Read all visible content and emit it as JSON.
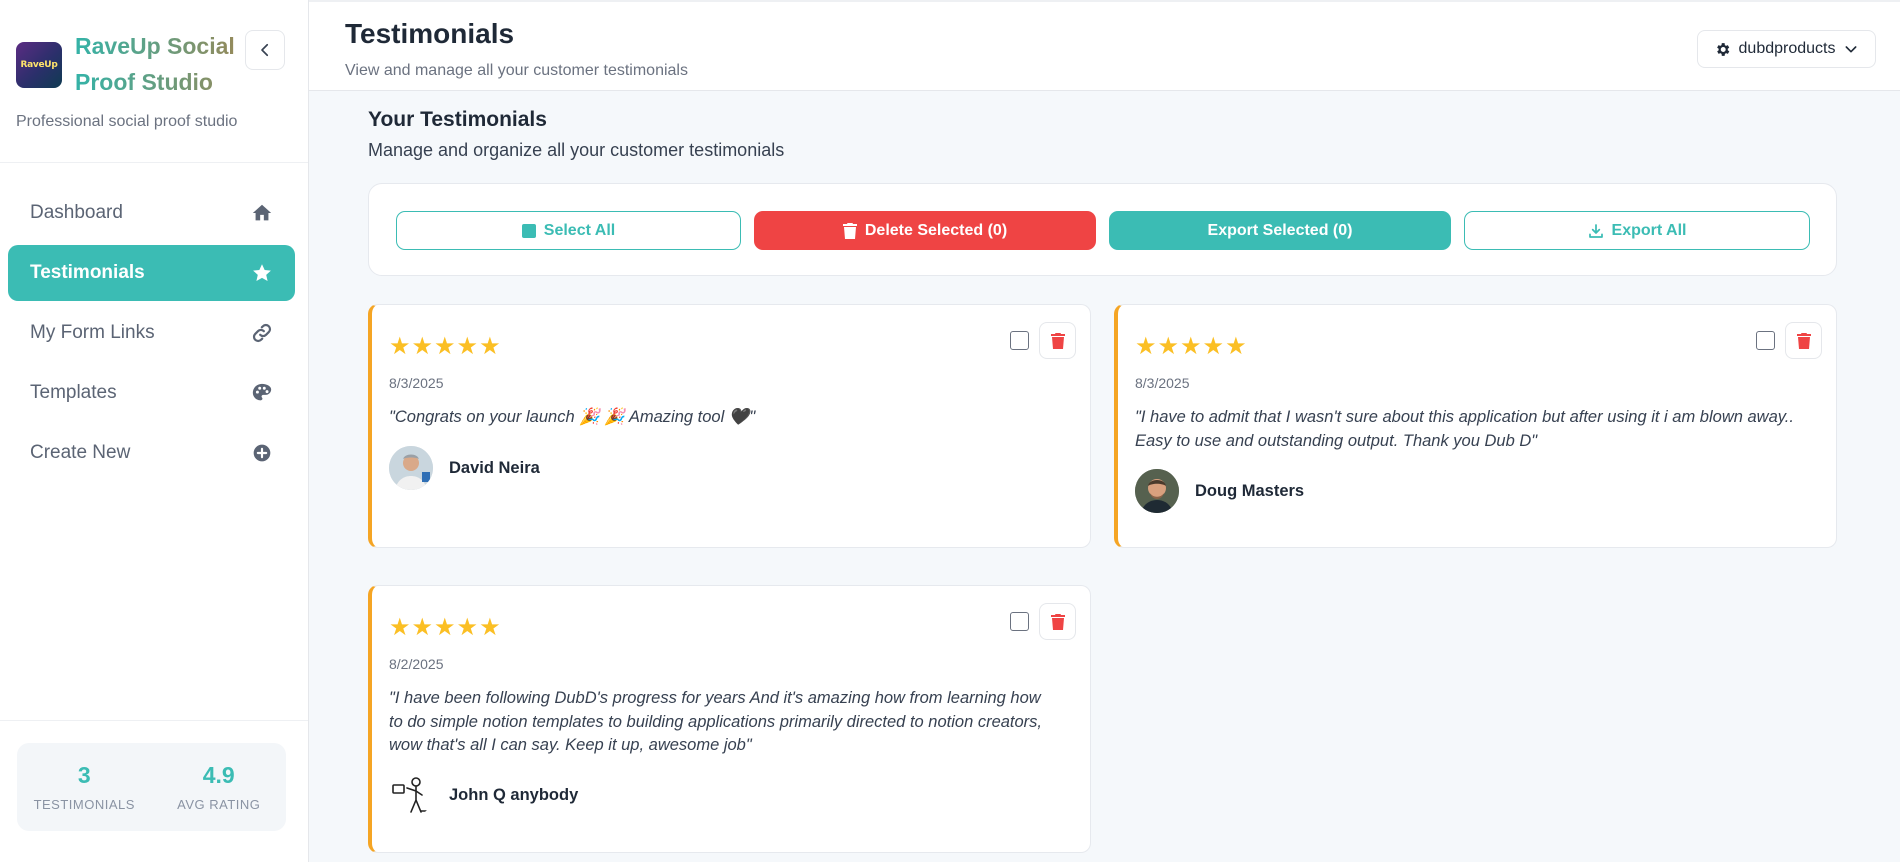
{
  "sidebar": {
    "logo_text": "RaveUp",
    "brand_name": "RaveUp Social Proof Studio",
    "tagline": "Professional social proof studio",
    "nav": [
      {
        "label": "Dashboard",
        "icon": "home-icon",
        "active": false
      },
      {
        "label": "Testimonials",
        "icon": "star-icon",
        "active": true
      },
      {
        "label": "My Form Links",
        "icon": "link-icon",
        "active": false
      },
      {
        "label": "Templates",
        "icon": "palette-icon",
        "active": false
      },
      {
        "label": "Create New",
        "icon": "plus-circle-icon",
        "active": false
      }
    ],
    "stats": [
      {
        "value": "3",
        "label": "TESTIMONIALS"
      },
      {
        "value": "4.9",
        "label": "AVG RATING"
      }
    ]
  },
  "header": {
    "title": "Testimonials",
    "subtitle": "View and manage all your customer testimonials",
    "account": "dubdproducts"
  },
  "main": {
    "section_title": "Your Testimonials",
    "section_subtitle": "Manage and organize all your customer testimonials",
    "toolbar": {
      "select_all": "Select All",
      "delete_selected": "Delete Selected (0)",
      "export_selected": "Export Selected (0)",
      "export_all": "Export All"
    },
    "testimonials": [
      {
        "rating": 5,
        "stars": "★★★★★",
        "date": "8/3/2025",
        "quote_lines": [
          "\"Congrats on your launch 🎉 🎉 Amazing tool 🖤\""
        ],
        "author": "David Neira"
      },
      {
        "rating": 5,
        "stars": "★★★★★",
        "date": "8/3/2025",
        "quote_lines": [
          "\"I have to admit that I wasn't sure about this application but after using it i am blown away..",
          "Easy to use and outstanding output. Thank you Dub D\""
        ],
        "author": "Doug Masters"
      },
      {
        "rating": 5,
        "stars": "★★★★★",
        "date": "8/2/2025",
        "quote_lines": [
          "\"I have been following DubD's progress for years And it's amazing how from learning how",
          "to do simple notion templates to building applications primarily directed to notion creators,",
          "wow that's all I can say. Keep it up, awesome job\""
        ],
        "author": "John Q anybody"
      }
    ]
  },
  "colors": {
    "accent": "#3bbcb4",
    "danger": "#ef4444",
    "star": "#fbbf24",
    "card_border": "#f5a524"
  }
}
